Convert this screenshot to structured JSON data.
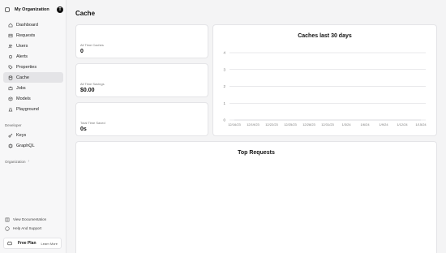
{
  "org": {
    "name": "My Organization",
    "avatar": "T"
  },
  "nav": [
    {
      "label": "Dashboard",
      "icon": "home-icon"
    },
    {
      "label": "Requests",
      "icon": "table-icon"
    },
    {
      "label": "Users",
      "icon": "users-icon"
    },
    {
      "label": "Alerts",
      "icon": "bell-icon"
    },
    {
      "label": "Properties",
      "icon": "tag-icon"
    },
    {
      "label": "Cache",
      "icon": "database-icon",
      "active": true
    },
    {
      "label": "Jobs",
      "icon": "briefcase-icon"
    },
    {
      "label": "Models",
      "icon": "cube-icon"
    },
    {
      "label": "Playground",
      "icon": "beaker-icon"
    }
  ],
  "sections": {
    "developer": "Developer",
    "organization": "Organization"
  },
  "dev_nav": [
    {
      "label": "Keys",
      "icon": "key-icon"
    },
    {
      "label": "GraphQL",
      "icon": "graphql-icon"
    }
  ],
  "bottom": {
    "docs": "View Documentation",
    "support": "Help And Support"
  },
  "plan": {
    "name": "Free Plan",
    "link": "Learn More"
  },
  "page": {
    "title": "Cache"
  },
  "stats": [
    {
      "label": "All Time Caches",
      "value": "0"
    },
    {
      "label": "All Time Savings",
      "value": "$0.00"
    },
    {
      "label": "Total Time Saved",
      "value": "0s"
    }
  ],
  "chart_data": {
    "type": "line",
    "title": "Caches last 30 days",
    "x": [
      "12/16/23",
      "12/19/23",
      "12/22/23",
      "12/25/23",
      "12/28/23",
      "12/31/23",
      "1/3/24",
      "1/6/24",
      "1/9/24",
      "1/12/24",
      "1/15/24"
    ],
    "series": [
      {
        "values": [
          0,
          0,
          0,
          0,
          0,
          0,
          0,
          0,
          0,
          0,
          0
        ]
      }
    ],
    "yticks": [
      0,
      1,
      2,
      3,
      4
    ],
    "ylim": [
      0,
      4
    ],
    "grid": true,
    "accent": "#d4d4d8"
  },
  "top_requests": {
    "title": "Top Requests"
  }
}
